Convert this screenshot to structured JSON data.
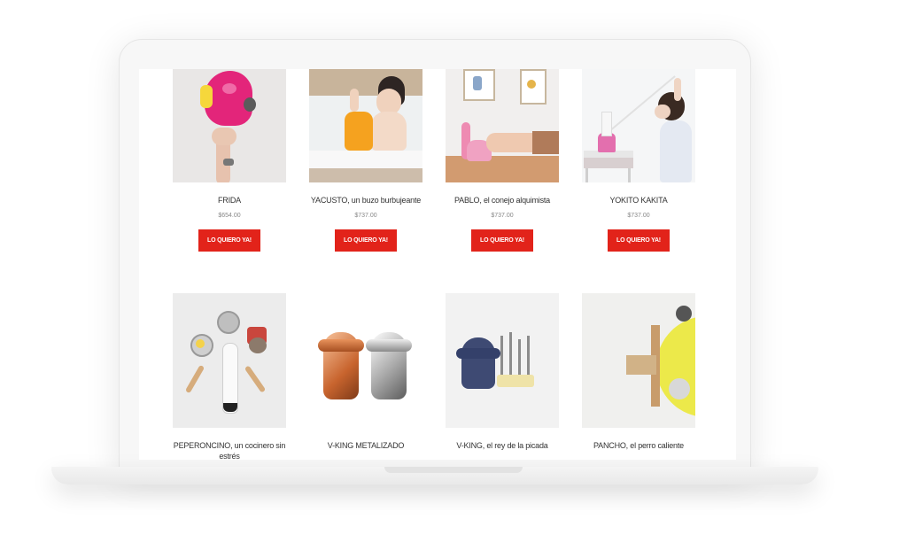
{
  "products": [
    {
      "name": "FRIDA",
      "price": "$654.00",
      "cta": "LO QUIERO YA!"
    },
    {
      "name": "YACUSTO, un buzo burbujeante",
      "price": "$737.00",
      "cta": "LO QUIERO YA!"
    },
    {
      "name": "PABLO, el conejo alquimista",
      "price": "$737.00",
      "cta": "LO QUIERO YA!"
    },
    {
      "name": "YOKITO KAKITA",
      "price": "$737.00",
      "cta": "LO QUIERO YA!"
    },
    {
      "name": "PEPERONCINO, un cocinero sin estrés"
    },
    {
      "name": "V-KING METALIZADO"
    },
    {
      "name": "V-KING, el rey de la picada"
    },
    {
      "name": "PANCHO, el perro caliente"
    }
  ],
  "colors": {
    "accent": "#e2231a",
    "frame": "#f7f7f7"
  },
  "icons": [
    "pink-toy-image",
    "bath-child-image",
    "bunny-toy-image",
    "child-stairs-image",
    "kitchen-utensils-image",
    "metal-figures-image",
    "viking-picks-image",
    "yellow-dog-image"
  ]
}
